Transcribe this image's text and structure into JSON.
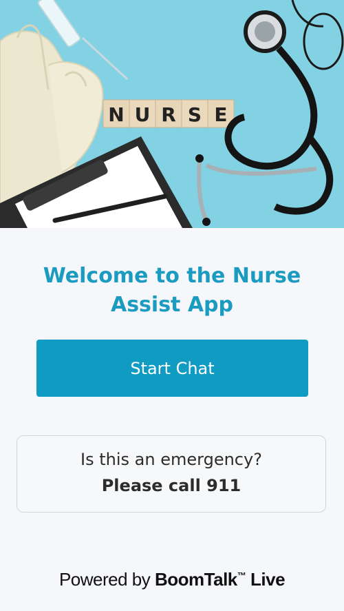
{
  "hero": {
    "image_name": "nurse-hero-image",
    "tiles": [
      "N",
      "U",
      "R",
      "S",
      "E"
    ],
    "background_color": "#7fd0e2"
  },
  "welcome": {
    "line1": "Welcome to the Nurse",
    "line2": "Assist App"
  },
  "start_chat": {
    "label": "Start Chat"
  },
  "emergency": {
    "question": "Is this an emergency?",
    "action": "Please call 911"
  },
  "footer": {
    "prefix": "Powered by",
    "brand": "BoomTalk",
    "trademark": "™",
    "suffix": "Live"
  },
  "colors": {
    "accent": "#0f9bc2",
    "heading": "#1b9bbf",
    "page_bg": "#f5f7fb"
  }
}
